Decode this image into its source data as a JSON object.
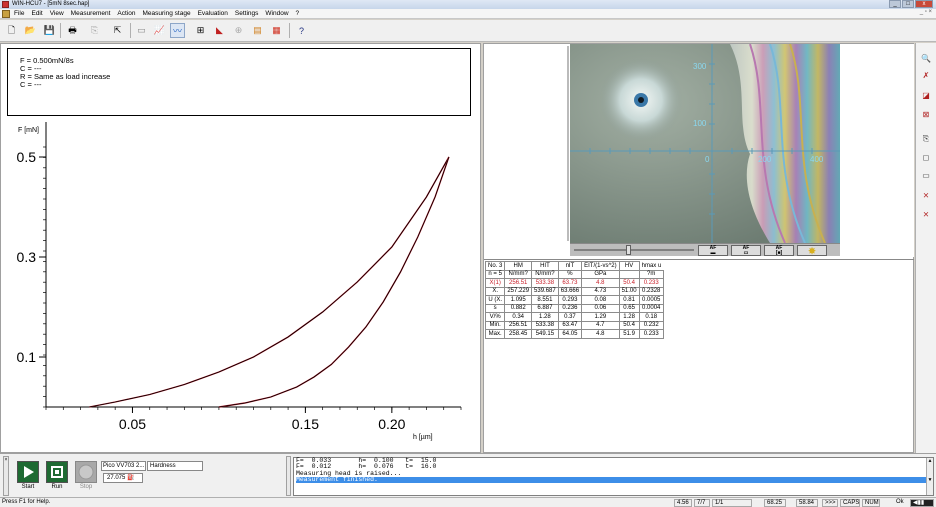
{
  "window": {
    "title": "WIN-HCU7 - [5mN 8sec.hap]"
  },
  "menu": [
    "File",
    "Edit",
    "View",
    "Measurement",
    "Action",
    "Measuring stage",
    "Evaluation",
    "Settings",
    "Window",
    "?"
  ],
  "info": {
    "lines": [
      "F = 0.500mN/8s",
      "C = ---",
      "R = Same as load increase",
      "C = ---"
    ]
  },
  "chart_data": {
    "type": "line",
    "ylabel": "F [mN]",
    "xlabel": "h [µm]",
    "y_ticks": [
      "0.5",
      "0.3",
      "0.1"
    ],
    "x_ticks": [
      "0.05",
      "0.15",
      "0.20"
    ],
    "x_range": [
      0.0,
      0.24
    ],
    "y_range": [
      0.0,
      0.52
    ],
    "series": [
      {
        "x": [
          0.025,
          0.04,
          0.06,
          0.08,
          0.1,
          0.12,
          0.14,
          0.16,
          0.18,
          0.2,
          0.22,
          0.233
        ],
        "y": [
          0.0,
          0.01,
          0.025,
          0.045,
          0.07,
          0.1,
          0.14,
          0.19,
          0.25,
          0.32,
          0.42,
          0.5
        ]
      },
      {
        "x": [
          0.233,
          0.225,
          0.215,
          0.205,
          0.195,
          0.185,
          0.175,
          0.165,
          0.155,
          0.145,
          0.13,
          0.115,
          0.1
        ],
        "y": [
          0.5,
          0.42,
          0.34,
          0.27,
          0.21,
          0.16,
          0.12,
          0.085,
          0.06,
          0.04,
          0.02,
          0.008,
          0.0
        ]
      }
    ]
  },
  "image": {
    "ticks_y": [
      "300",
      "100"
    ],
    "ticks_x": [
      "0",
      "200",
      "400"
    ],
    "af_buttons": [
      "AF",
      "AF",
      "AF",
      ""
    ]
  },
  "table": {
    "header": [
      "No. 3",
      "HM",
      "HIT",
      "nIT",
      "EIT/(1-vs^2)",
      "HV",
      "hmax u"
    ],
    "units": [
      "n = 5",
      "N/mm?",
      "N/mm?",
      "%",
      "GPa",
      "",
      "?m"
    ],
    "rows": [
      {
        "cells": [
          "X(1)",
          "256.51",
          "533.38",
          "63.73",
          "4.8",
          "50.4",
          "0.233"
        ],
        "red": true
      },
      {
        "cells": [
          "X.",
          "257.229",
          "539.687",
          "63.666",
          "4.73",
          "51.00",
          "0.2328"
        ],
        "red": false
      },
      {
        "cells": [
          "U (X.",
          "1.095",
          "8.551",
          "0.293",
          "0.08",
          "0.81",
          "0.0005"
        ],
        "red": false
      },
      {
        "cells": [
          "s",
          "0.882",
          "6.887",
          "0.236",
          "0.06",
          "0.65",
          "0.0004"
        ],
        "red": false
      },
      {
        "cells": [
          "V/%",
          "0.34",
          "1.28",
          "0.37",
          "1.29",
          "1.28",
          "0.18"
        ],
        "red": false
      },
      {
        "cells": [
          "Min.",
          "256.51",
          "533.38",
          "63.47",
          "4.7",
          "50.4",
          "0.232"
        ],
        "red": false
      },
      {
        "cells": [
          "Max.",
          "258.45",
          "549.15",
          "64.05",
          "4.8",
          "51.9",
          "0.233"
        ],
        "red": false
      }
    ]
  },
  "controls": {
    "start": "Start",
    "run": "Run",
    "stop": "Stop",
    "instrument": "Pico VV703 2...",
    "mode": "Hardness",
    "position": "27.075"
  },
  "messages": [
    "F=  0.033       h=  0.100   t=  15.0",
    "F=  0.012       h=  0.076   t=  16.0",
    "Measuring head is raised...",
    "Measurement finished."
  ],
  "status": {
    "help": "Press F1 for Help.",
    "v1": "4.56",
    "v2": "7/7",
    "v3": "1/1",
    "v4": "68.25",
    "v5": "58.84",
    "v6": ">>>",
    "caps": "CAPS",
    "num": "NUM",
    "ok": "Ok"
  }
}
